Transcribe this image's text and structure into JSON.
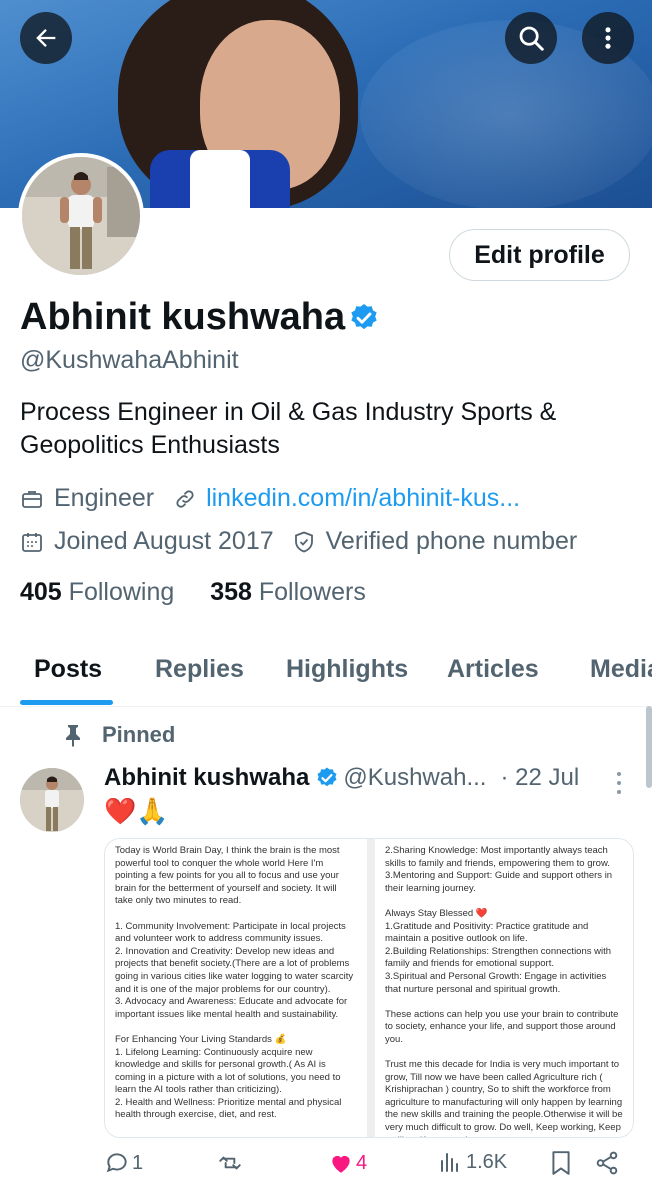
{
  "header": {
    "back_icon": "arrow-left-icon",
    "search_icon": "search-icon",
    "more_icon": "more-vertical-icon"
  },
  "profile": {
    "name": "Abhinit kushwaha",
    "handle": "@KushwahaAbhinit",
    "bio": "Process Engineer in Oil & Gas Industry Sports & Geopolitics Enthusiasts",
    "edit_button": "Edit profile",
    "job": "Engineer",
    "link": "linkedin.com/in/abhinit-kus...",
    "joined": "Joined August 2017",
    "verified_phone": "Verified phone number",
    "following_count": "405",
    "following_label": "Following",
    "followers_count": "358",
    "followers_label": "Followers",
    "verified_color": "#1d9bf0"
  },
  "tabs": [
    {
      "label": "Posts",
      "active": true
    },
    {
      "label": "Replies"
    },
    {
      "label": "Highlights"
    },
    {
      "label": "Articles"
    },
    {
      "label": "Media"
    }
  ],
  "post": {
    "pinned_label": "Pinned",
    "author_name": "Abhinit kushwaha",
    "author_handle": "@Kushwah...",
    "time": "· 22 Jul",
    "text": "❤️🙏",
    "image_left_text": "Today is World Brain Day, I think the brain is the most powerful tool to conquer the whole world Here I'm pointing a few points for you all to focus and use your brain for the betterment of yourself and society. It will take only two minutes to read.\n\n1. Community Involvement: Participate in local projects and volunteer work to address community issues.\n2. Innovation and Creativity: Develop new ideas and projects that benefit society.(There are a lot of problems going in various cities like water logging to water scarcity and it is one of the major problems for our country).\n3. Advocacy and Awareness: Educate and advocate for important issues like mental health and sustainability.\n\nFor Enhancing Your Living Standards 💰\n1. Lifelong Learning: Continuously acquire new knowledge and skills for personal growth.( As AI is coming in a picture with a lot of solutions, you need to learn the AI tools rather than criticizing).\n2. Health and Wellness: Prioritize mental and physical health through exercise, diet, and rest.",
    "image_right_text": "2.Sharing Knowledge: Most importantly always teach skills to family and friends, empowering them to grow.\n3.Mentoring and Support: Guide and support others in their learning journey.\n\nAlways Stay Blessed ❤️\n1.Gratitude and Positivity: Practice gratitude and maintain a positive outlook on life.\n2.Building Relationships: Strengthen connections with family and friends for emotional support.\n3.Spiritual and Personal Growth: Engage in activities that nurture personal and spiritual growth.\n\nThese actions can help you use your brain to contribute to society, enhance your life, and support those around you.\n\nTrust me this decade for India is very much important to grow, Till now we have been called Agriculture rich ( Krishiprachan ) country, So to shift the workforce from agriculture to manufacturing will only happen by learning the new skills and training the people.Otherwise it will be very much difficult to grow. Do well, Keep working, Keep smiling, Keep growing.",
    "replies": "1",
    "reposts": "",
    "likes": "4",
    "views": "1.6K",
    "like_color": "#f91880"
  }
}
